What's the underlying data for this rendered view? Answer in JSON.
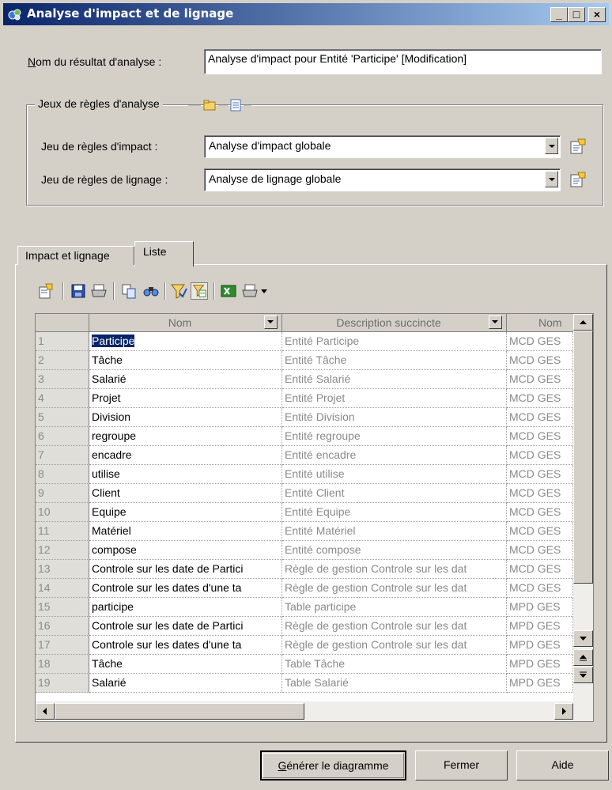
{
  "window": {
    "title": "Analyse d'impact et de lignage",
    "minimize_glyph": "_",
    "maximize_glyph": "□",
    "close_glyph": "×"
  },
  "result": {
    "label": "Nom du résultat d'analyse :",
    "value": "Analyse d'impact pour Entité 'Participe' [Modification]"
  },
  "rulesets": {
    "group_title": "Jeux de règles d'analyse",
    "impact_label": "Jeu de règles d'impact :",
    "impact_value": "Analyse d'impact globale",
    "lineage_label": "Jeu de règles de lignage :",
    "lineage_value": "Analyse de lignage globale"
  },
  "tabs": [
    {
      "label": "Impact et lignage",
      "active": false
    },
    {
      "label": "Liste",
      "active": true
    }
  ],
  "toolbar_icons": [
    "properties-icon",
    "save-icon",
    "print-icon",
    "copy-icon",
    "find-icon",
    "filter-icon",
    "customize-columns-icon",
    "excel-export-icon",
    "print-list-icon",
    "dropdown-arrow-icon"
  ],
  "grid": {
    "columns": [
      "Nom",
      "Description succincte",
      "Nom"
    ],
    "rows": [
      {
        "n": "1",
        "nom": "Participe",
        "desc": "Entité Participe",
        "model": "MCD GES"
      },
      {
        "n": "2",
        "nom": "Tâche",
        "desc": "Entité Tâche",
        "model": "MCD GES"
      },
      {
        "n": "3",
        "nom": "Salarié",
        "desc": "Entité Salarié",
        "model": "MCD GES"
      },
      {
        "n": "4",
        "nom": "Projet",
        "desc": "Entité Projet",
        "model": "MCD GES"
      },
      {
        "n": "5",
        "nom": "Division",
        "desc": "Entité Division",
        "model": "MCD GES"
      },
      {
        "n": "6",
        "nom": "regroupe",
        "desc": "Entité regroupe",
        "model": "MCD GES"
      },
      {
        "n": "7",
        "nom": "encadre",
        "desc": "Entité encadre",
        "model": "MCD GES"
      },
      {
        "n": "8",
        "nom": "utilise",
        "desc": "Entité utilise",
        "model": "MCD GES"
      },
      {
        "n": "9",
        "nom": "Client",
        "desc": "Entité Client",
        "model": "MCD GES"
      },
      {
        "n": "10",
        "nom": "Equipe",
        "desc": "Entité Equipe",
        "model": "MCD GES"
      },
      {
        "n": "11",
        "nom": "Matériel",
        "desc": "Entité Matériel",
        "model": "MCD GES"
      },
      {
        "n": "12",
        "nom": "compose",
        "desc": "Entité compose",
        "model": "MCD GES"
      },
      {
        "n": "13",
        "nom": "Controle sur les date de Partici",
        "desc": "Règle de gestion Controle sur les dat",
        "model": "MCD GES"
      },
      {
        "n": "14",
        "nom": "Controle sur les dates d'une ta",
        "desc": "Règle de gestion Controle sur les dat",
        "model": "MCD GES"
      },
      {
        "n": "15",
        "nom": "participe",
        "desc": "Table participe",
        "model": "MPD GES"
      },
      {
        "n": "16",
        "nom": "Controle sur les date de Partici",
        "desc": "Règle de gestion Controle sur les dat",
        "model": "MPD GES"
      },
      {
        "n": "17",
        "nom": "Controle sur les dates d'une ta",
        "desc": "Règle de gestion Controle sur les dat",
        "model": "MPD GES"
      },
      {
        "n": "18",
        "nom": "Tâche",
        "desc": "Table Tâche",
        "model": "MPD GES"
      },
      {
        "n": "19",
        "nom": "Salarié",
        "desc": "Table Salarié",
        "model": "MPD GES"
      }
    ]
  },
  "buttons": {
    "generate": "Générer le diagramme",
    "close": "Fermer",
    "help": "Aide"
  },
  "colors": {
    "face": "#d4d0c8",
    "titlebar_start": "#0a246a",
    "titlebar_end": "#a6caf0",
    "selection": "#0a246a"
  }
}
